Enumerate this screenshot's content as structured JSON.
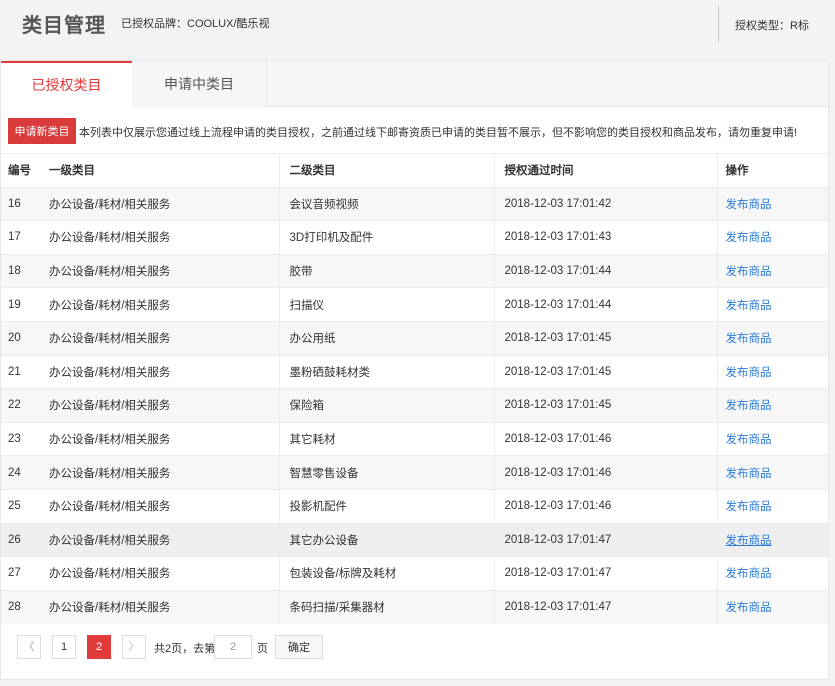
{
  "header": {
    "title": "类目管理",
    "brand_info": "已授权品牌：COOLUX/酷乐视",
    "auth_type": "授权类型：R标"
  },
  "tabs": [
    {
      "label": "已授权类目",
      "active": true
    },
    {
      "label": "申请中类目",
      "active": false
    }
  ],
  "notice": {
    "button_label": "申请新类目",
    "text": "本列表中仅展示您通过线上流程申请的类目授权，之前通过线下邮寄资质已申请的类目暂不展示，但不影响您的类目授权和商品发布，请勿重复申请!"
  },
  "table": {
    "columns": [
      "编号",
      "一级类目",
      "二级类目",
      "授权通过时间",
      "操作"
    ],
    "rows": [
      {
        "id": "16",
        "level1": "办公设备/耗材/相关服务",
        "level2": "会议音频视频",
        "time": "2018-12-03 17:01:42",
        "action": "发布商品"
      },
      {
        "id": "17",
        "level1": "办公设备/耗材/相关服务",
        "level2": "3D打印机及配件",
        "time": "2018-12-03 17:01:43",
        "action": "发布商品"
      },
      {
        "id": "18",
        "level1": "办公设备/耗材/相关服务",
        "level2": "胶带",
        "time": "2018-12-03 17:01:44",
        "action": "发布商品"
      },
      {
        "id": "19",
        "level1": "办公设备/耗材/相关服务",
        "level2": "扫描仪",
        "time": "2018-12-03 17:01:44",
        "action": "发布商品"
      },
      {
        "id": "20",
        "level1": "办公设备/耗材/相关服务",
        "level2": "办公用纸",
        "time": "2018-12-03 17:01:45",
        "action": "发布商品"
      },
      {
        "id": "21",
        "level1": "办公设备/耗材/相关服务",
        "level2": "墨粉硒鼓耗材类",
        "time": "2018-12-03 17:01:45",
        "action": "发布商品"
      },
      {
        "id": "22",
        "level1": "办公设备/耗材/相关服务",
        "level2": "保险箱",
        "time": "2018-12-03 17:01:45",
        "action": "发布商品"
      },
      {
        "id": "23",
        "level1": "办公设备/耗材/相关服务",
        "level2": "其它耗材",
        "time": "2018-12-03 17:01:46",
        "action": "发布商品"
      },
      {
        "id": "24",
        "level1": "办公设备/耗材/相关服务",
        "level2": "智慧零售设备",
        "time": "2018-12-03 17:01:46",
        "action": "发布商品"
      },
      {
        "id": "25",
        "level1": "办公设备/耗材/相关服务",
        "level2": "投影机配件",
        "time": "2018-12-03 17:01:46",
        "action": "发布商品"
      },
      {
        "id": "26",
        "level1": "办公设备/耗材/相关服务",
        "level2": "其它办公设备",
        "time": "2018-12-03 17:01:47",
        "action": "发布商品"
      },
      {
        "id": "27",
        "level1": "办公设备/耗材/相关服务",
        "level2": "包装设备/标牌及耗材",
        "time": "2018-12-03 17:01:47",
        "action": "发布商品"
      },
      {
        "id": "28",
        "level1": "办公设备/耗材/相关服务",
        "level2": "条码扫描/采集器材",
        "time": "2018-12-03 17:01:47",
        "action": "发布商品"
      }
    ]
  },
  "pager": {
    "prev": "〈",
    "next": "〉",
    "pages": [
      "1",
      "2"
    ],
    "current_page": "2",
    "total_text": "共2页，去第",
    "goto_value": "2",
    "unit": "页",
    "confirm_label": "确定"
  },
  "colors": {
    "accent": "#e23b3b",
    "link": "#2b7bd6"
  }
}
